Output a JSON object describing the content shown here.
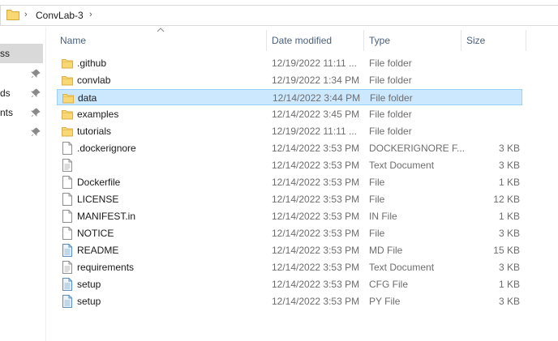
{
  "address": {
    "crumb": "ConvLab-3"
  },
  "nav": {
    "items": [
      {
        "label": "ss",
        "selected": true
      },
      {
        "label": "",
        "pinned": true
      },
      {
        "label": "ds",
        "pinned": true
      },
      {
        "label": "nts",
        "pinned": true
      },
      {
        "label": "",
        "pinned": true
      }
    ]
  },
  "columns": {
    "name": "Name",
    "date": "Date modified",
    "type": "Type",
    "size": "Size"
  },
  "rows": [
    {
      "name": ".github",
      "date": "12/19/2022 11:11 ...",
      "type": "File folder",
      "size": "",
      "icon": "folder"
    },
    {
      "name": "convlab",
      "date": "12/19/2022 1:34 PM",
      "type": "File folder",
      "size": "",
      "icon": "folder"
    },
    {
      "name": "data",
      "date": "12/14/2022 3:44 PM",
      "type": "File folder",
      "size": "",
      "icon": "folder",
      "selected": true
    },
    {
      "name": "examples",
      "date": "12/14/2022 3:45 PM",
      "type": "File folder",
      "size": "",
      "icon": "folder"
    },
    {
      "name": "tutorials",
      "date": "12/19/2022 11:11 ...",
      "type": "File folder",
      "size": "",
      "icon": "folder"
    },
    {
      "name": ".dockerignore",
      "date": "12/14/2022 3:53 PM",
      "type": "DOCKERIGNORE F...",
      "size": "3 KB",
      "icon": "file"
    },
    {
      "name": "",
      "date": "12/14/2022 3:53 PM",
      "type": "Text Document",
      "size": "3 KB",
      "icon": "text"
    },
    {
      "name": "Dockerfile",
      "date": "12/14/2022 3:53 PM",
      "type": "File",
      "size": "1 KB",
      "icon": "file"
    },
    {
      "name": "LICENSE",
      "date": "12/14/2022 3:53 PM",
      "type": "File",
      "size": "12 KB",
      "icon": "file"
    },
    {
      "name": "MANIFEST.in",
      "date": "12/14/2022 3:53 PM",
      "type": "IN File",
      "size": "1 KB",
      "icon": "file"
    },
    {
      "name": "NOTICE",
      "date": "12/14/2022 3:53 PM",
      "type": "File",
      "size": "3 KB",
      "icon": "file"
    },
    {
      "name": "README",
      "date": "12/14/2022 3:53 PM",
      "type": "MD File",
      "size": "15 KB",
      "icon": "blue"
    },
    {
      "name": "requirements",
      "date": "12/14/2022 3:53 PM",
      "type": "Text Document",
      "size": "3 KB",
      "icon": "text"
    },
    {
      "name": "setup",
      "date": "12/14/2022 3:53 PM",
      "type": "CFG File",
      "size": "1 KB",
      "icon": "blue"
    },
    {
      "name": "setup",
      "date": "12/14/2022 3:53 PM",
      "type": "PY File",
      "size": "3 KB",
      "icon": "blue"
    }
  ],
  "colors": {
    "selection": "#cce8ff",
    "selection_border": "#99d1ff",
    "header_text": "#4c607a",
    "folder": "#f8d775"
  }
}
